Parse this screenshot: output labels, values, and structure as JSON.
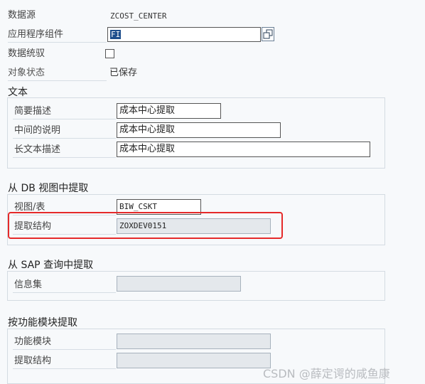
{
  "header": {
    "datasource_label": "数据源",
    "datasource_value": "ZCOST_CENTER",
    "app_component_label": "应用程序组件",
    "app_component_value": "FI",
    "data_security_label": "数据统驭",
    "data_security_checked": false,
    "object_status_label": "对象状态",
    "object_status_value": "已保存"
  },
  "text_section": {
    "title": "文本",
    "short_desc_label": "简要描述",
    "short_desc_value": "成本中心提取",
    "medium_desc_label": "中间的说明",
    "medium_desc_value": "成本中心提取",
    "long_desc_label": "长文本描述",
    "long_desc_value": "成本中心提取"
  },
  "db_view_section": {
    "title": "从 DB 视图中提取",
    "view_table_label": "视图/表",
    "view_table_value": "BIW_CSKT",
    "extract_structure_label": "提取结构",
    "extract_structure_value": "ZOXDEV0151"
  },
  "sap_query_section": {
    "title": "从 SAP 查询中提取",
    "infoset_label": "信息集",
    "infoset_value": ""
  },
  "function_module_section": {
    "title": "按功能模块提取",
    "function_module_label": "功能模块",
    "function_module_value": "",
    "extract_structure_label": "提取结构",
    "extract_structure_value": ""
  },
  "watermark": "CSDN @薛定谔的咸鱼康",
  "colors": {
    "highlight": "#e52a2a",
    "selection": "#1e4e8c"
  },
  "icons": {
    "value_help": "copy-icon"
  }
}
